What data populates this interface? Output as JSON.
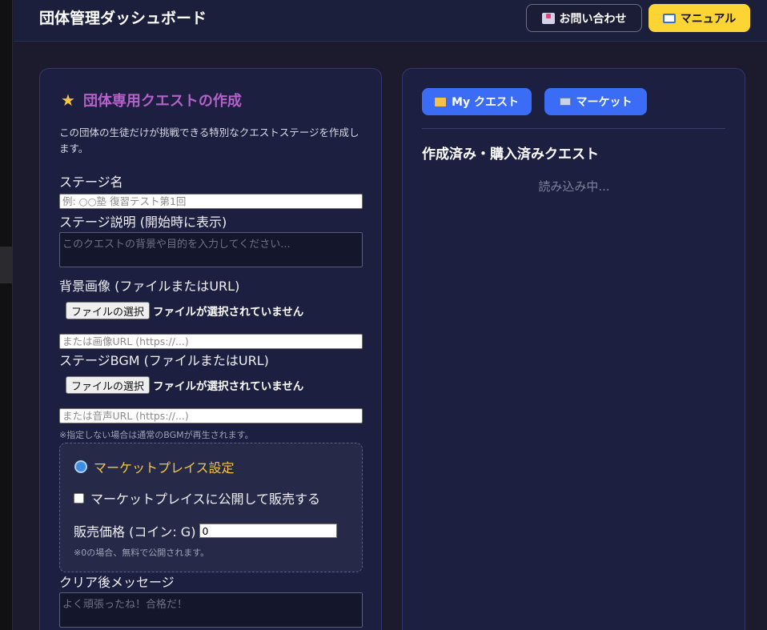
{
  "header": {
    "title": "団体管理ダッシュボード",
    "contact_label": "お問い合わせ",
    "manual_label": "マニュアル"
  },
  "create_panel": {
    "title": "団体専用クエストの作成",
    "description": "この団体の生徒だけが挑戦できる特別なクエストステージを作成します。",
    "stage_name_label": "ステージ名",
    "stage_name_placeholder": "例: ○○塾 復習テスト第1回",
    "stage_desc_label": "ステージ説明 (開始時に表示)",
    "stage_desc_placeholder": "このクエストの背景や目的を入力してください...",
    "bg_label": "背景画像 (ファイルまたはURL)",
    "file_button_label": "ファイルの選択",
    "no_file_text": "ファイルが選択されていません",
    "bg_url_placeholder": "または画像URL (https://...)",
    "bgm_label": "ステージBGM (ファイルまたはURL)",
    "bgm_url_placeholder": "または音声URL (https://...)",
    "bgm_note": "※指定しない場合は通常のBGMが再生されます。",
    "market": {
      "title": "マーケットプレイス設定",
      "publish_label": "マーケットプレイスに公開して販売する",
      "publish_checked": false,
      "price_label": "販売価格 (コイン: G)",
      "price_value": "0",
      "price_note": "※0の場合、無料で公開されます。"
    },
    "clear_msg_label": "クリア後メッセージ",
    "clear_msg_placeholder": "よく頑張ったね！合格だ！"
  },
  "quest_panel": {
    "tab_my_label": "My クエスト",
    "tab_market_label": "マーケット",
    "list_title": "作成済み・購入済みクエスト",
    "loading_text": "読み込み中..."
  },
  "colors": {
    "accent_blue": "#3b6cf6",
    "accent_yellow": "#fcd535",
    "title_purple": "#b462c9",
    "market_gold": "#f5c542"
  }
}
